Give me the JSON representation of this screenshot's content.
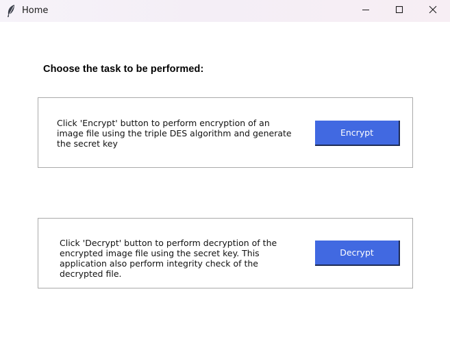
{
  "window": {
    "title": "Home",
    "icon": "feather-icon",
    "controls": [
      "minimize-icon",
      "maximize-icon",
      "close-icon"
    ]
  },
  "main": {
    "heading": "Choose the task to be performed:",
    "encrypt": {
      "description": "Click 'Encrypt' button to perform encryption of an image file using the triple DES algorithm and generate the secret key",
      "button_label": "Encrypt"
    },
    "decrypt": {
      "description": "Click 'Decrypt' button to perform decryption of the encrypted image file using the secret key. This application also perform integrity check of the decrypted file.",
      "button_label": "Decrypt"
    }
  },
  "colors": {
    "button_bg": "#4169e1",
    "button_text": "#ffffff",
    "box_border": "#a9a9a9"
  }
}
